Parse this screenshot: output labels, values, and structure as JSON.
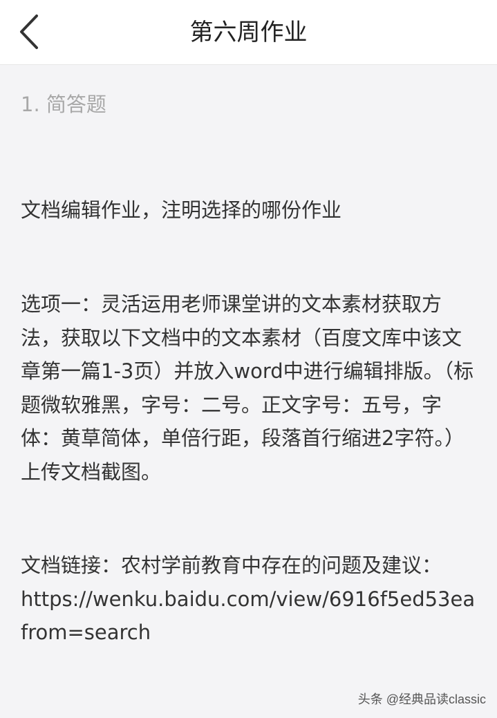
{
  "header": {
    "title": "第六周作业",
    "back_icon": "chevron-left-icon"
  },
  "question": {
    "number_label": "1. 简答题",
    "paragraphs": [
      "文档编辑作业，注明选择的哪份作业",
      "选项一：灵活运用老师课堂讲的文本素材获取方法，获取以下文档中的文本素材（百度文库中该文章第一篇1-3页）并放入word中进行编辑排版。（标题微软雅黑，字号：二号。正文字号：五号，字体：黄草简体，单倍行距，段落首行缩进2字符。）上传文档截图。",
      "文档链接：农村学前教育中存在的问题及建议："
    ],
    "link_line1": "https://wenku.baidu.com/view/6916f5ed53ea",
    "link_line2": "from=search"
  },
  "watermark": "头条 @经典品读classic",
  "colors": {
    "header_bg": "#ffffff",
    "page_bg": "#f4f4f6",
    "text": "#333333",
    "muted": "#a8a8a8"
  }
}
